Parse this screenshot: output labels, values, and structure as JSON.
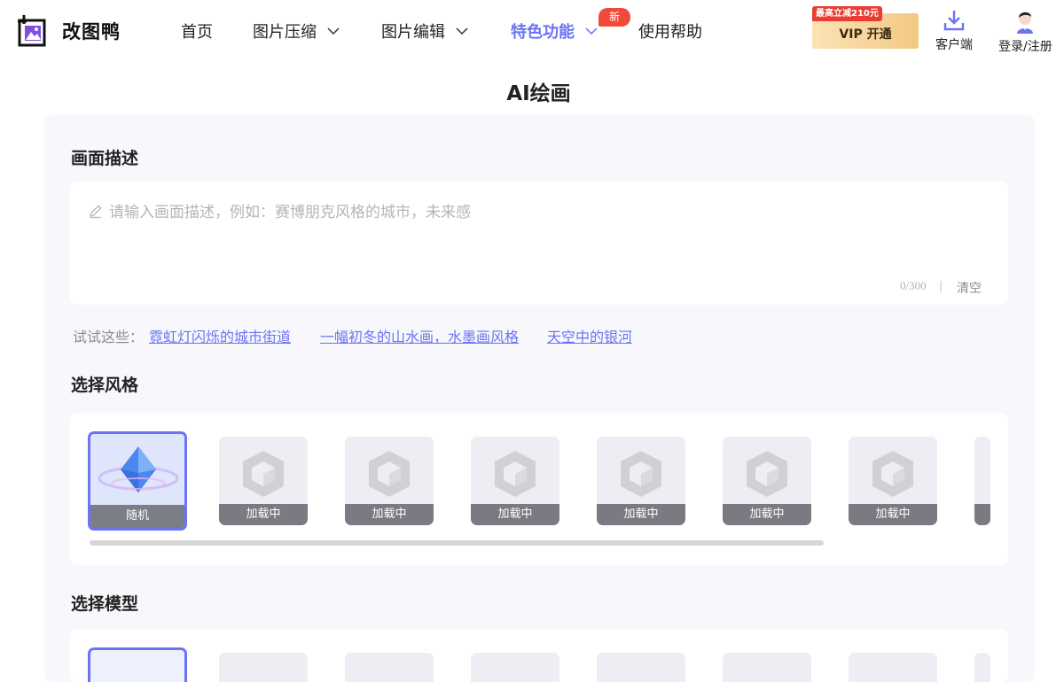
{
  "app": {
    "name": "改图鸭",
    "logo_icon": "image-crop-logo-icon"
  },
  "nav": {
    "items": [
      {
        "label": "首页",
        "has_dropdown": false
      },
      {
        "label": "图片压缩",
        "has_dropdown": true
      },
      {
        "label": "图片编辑",
        "has_dropdown": true
      },
      {
        "label": "特色功能",
        "has_dropdown": true,
        "active": true
      },
      {
        "label": "使用帮助",
        "has_dropdown": false
      }
    ],
    "new_badge": "新"
  },
  "header": {
    "vip_promo": "最高立减210元",
    "vip_label": "VIP 开通",
    "client_label": "客户端",
    "login_label": "登录/注册"
  },
  "page": {
    "title": "AI绘画"
  },
  "description": {
    "label": "画面描述",
    "placeholder": "请输入画面描述，例如：赛博朋克风格的城市，未来感",
    "value": "",
    "char_count": "0/300",
    "separator": "|",
    "clear_label": "清空"
  },
  "suggestions": {
    "label": "试试这些：",
    "items": [
      "霓虹灯闪烁的城市街道",
      "一幅初冬的山水画，水墨画风格",
      "天空中的银河"
    ]
  },
  "style": {
    "label": "选择风格",
    "cards": [
      {
        "label": "随机",
        "selected": true
      },
      {
        "label": "加载中"
      },
      {
        "label": "加载中"
      },
      {
        "label": "加载中"
      },
      {
        "label": "加载中"
      },
      {
        "label": "加载中"
      },
      {
        "label": "加载中"
      }
    ]
  },
  "model": {
    "label": "选择模型"
  },
  "colors": {
    "accent": "#6a73f2",
    "new_badge": "#f04a3a",
    "vip_gold": "#f2c984",
    "panel_bg": "#f8f8fc"
  }
}
